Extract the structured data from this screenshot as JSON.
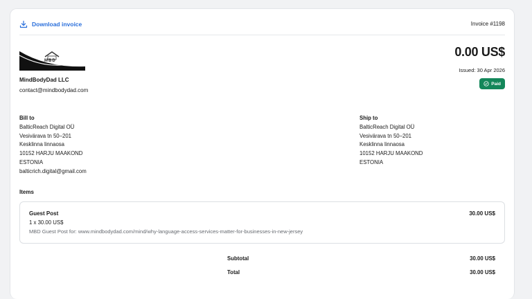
{
  "header": {
    "download_label": "Download invoice",
    "invoice_number": "Invoice #1198"
  },
  "company": {
    "logo_text": "MBD",
    "name": "MindBodyDad LLC",
    "email": "contact@mindbodydad.com"
  },
  "summary": {
    "total": "0.00 US$",
    "issued": "Issued: 30 Apr 2026",
    "status": "Paid"
  },
  "bill_to": {
    "heading": "Bill to",
    "lines": [
      "BalticReach Digital OÜ",
      "Vesivärava tn 50–201",
      "Kesklinna linnaosa",
      "10152 HARJU MAAKOND",
      "ESTONIA",
      "balticrich.digital@gmail.com"
    ]
  },
  "ship_to": {
    "heading": "Ship to",
    "lines": [
      "BalticReach Digital OÜ",
      "Vesivärava tn 50–201",
      "Kesklinna linnaosa",
      "10152 HARJU MAAKOND",
      "ESTONIA"
    ]
  },
  "items": {
    "heading": "Items",
    "list": [
      {
        "name": "Guest Post",
        "price": "30.00 US$",
        "qty": "1 x 30.00 US$",
        "description": "MBD Guest Post for: www.mindbodydad.com/mind/why-language-access-services-matter-for-businesses-in-new-jersey"
      }
    ]
  },
  "totals": {
    "subtotal_label": "Subtotal",
    "subtotal_value": "30.00 US$",
    "total_label": "Total",
    "total_value": "30.00 US$"
  },
  "colors": {
    "accent": "#2a6fdb",
    "paid": "#13875a"
  },
  "icons": {
    "download": "download-icon",
    "paid": "check-circle-icon"
  }
}
